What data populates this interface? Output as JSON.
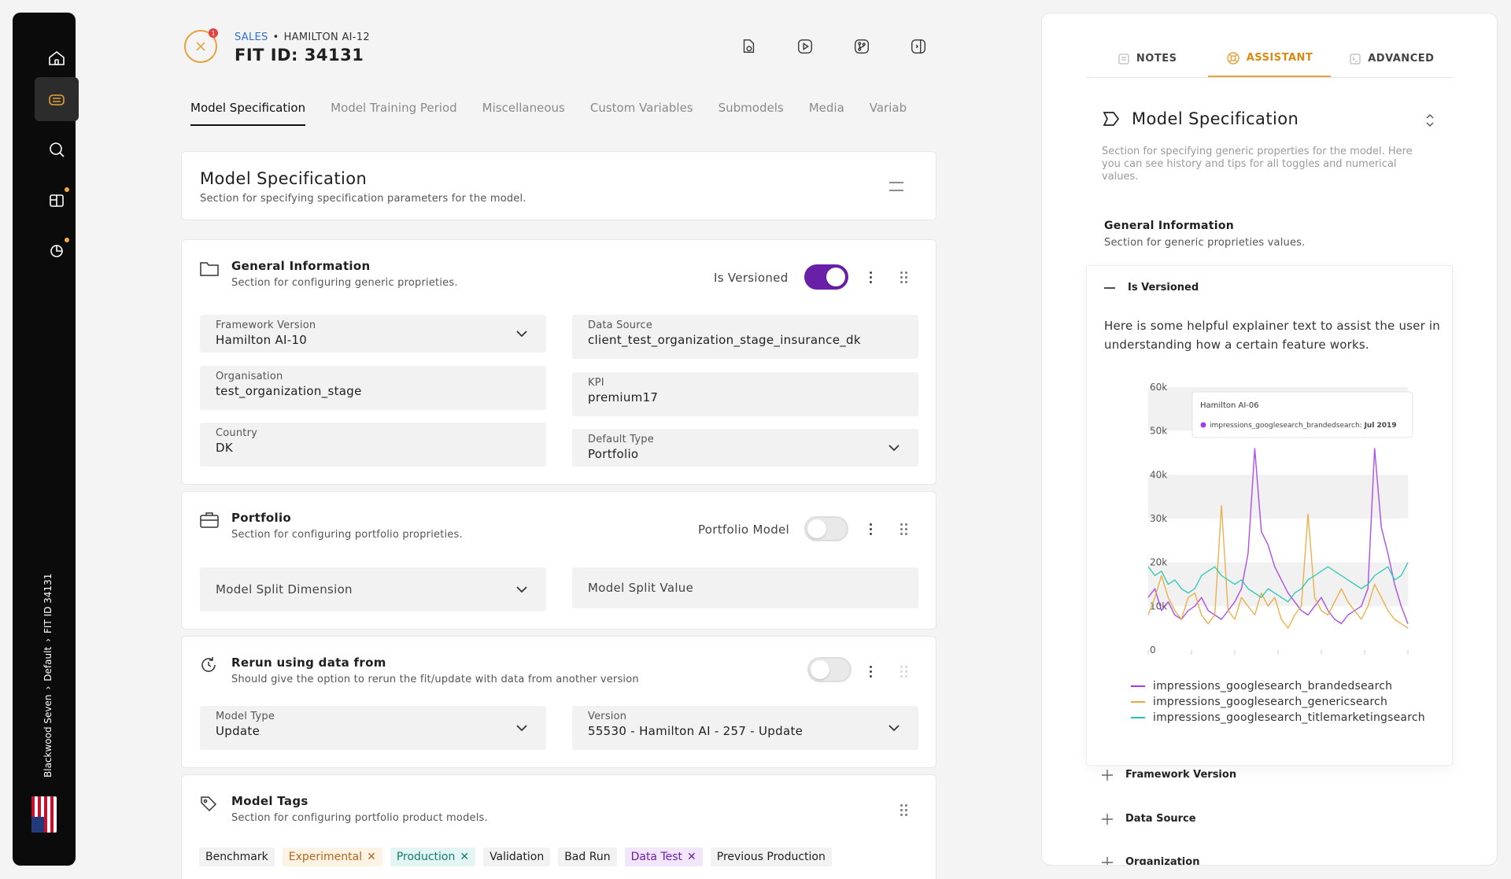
{
  "sidebar": {
    "breadcrumb": [
      "Blackwood Seven",
      "Default",
      "FIT ID 34131"
    ]
  },
  "header": {
    "breadcrumb_section": "SALES",
    "breadcrumb_separator": "•",
    "breadcrumb_model": "HAMILTON AI-12",
    "title": "FIT ID: 34131",
    "notification_count": "1"
  },
  "tabs": [
    {
      "label": "Model Specification",
      "active": true
    },
    {
      "label": "Model Training Period"
    },
    {
      "label": "Miscellaneous"
    },
    {
      "label": "Custom Variables"
    },
    {
      "label": "Submodels"
    },
    {
      "label": "Media"
    },
    {
      "label": "Variab"
    }
  ],
  "spec": {
    "title": "Model Specification",
    "subtitle": "Section for specifying specification parameters for the model."
  },
  "general": {
    "title": "General Information",
    "subtitle": "Section for configuring generic proprieties.",
    "toggle_label": "Is Versioned",
    "toggle_on": true,
    "fields": {
      "framework_version": {
        "label": "Framework Version",
        "value": "Hamilton AI-10"
      },
      "data_source": {
        "label": "Data Source",
        "value": "client_test_organization_stage_insurance_dk"
      },
      "organisation": {
        "label": "Organisation",
        "value": "test_organization_stage"
      },
      "kpi": {
        "label": "KPI",
        "value": "premium17"
      },
      "country": {
        "label": "Country",
        "value": "DK"
      },
      "default_type": {
        "label": "Default Type",
        "value": "Portfolio"
      }
    }
  },
  "portfolio": {
    "title": "Portfolio",
    "subtitle": "Section for configuring portfolio proprieties.",
    "toggle_label": "Portfolio Model",
    "toggle_on": false,
    "split_dimension_placeholder": "Model Split Dimension",
    "split_value_placeholder": "Model Split Value"
  },
  "rerun": {
    "title": "Rerun using data from",
    "subtitle": "Should give the option to rerun the fit/update with data from another version",
    "toggle_on": false,
    "model_type": {
      "label": "Model Type",
      "value": "Update"
    },
    "version": {
      "label": "Version",
      "value": "55530 - Hamilton AI - 257 - Update"
    }
  },
  "tags": {
    "title": "Model Tags",
    "subtitle": "Section for configuring portfolio product models.",
    "items": [
      {
        "label": "Benchmark"
      },
      {
        "label": "Experimental",
        "style": "exp"
      },
      {
        "label": "Production",
        "style": "prod"
      },
      {
        "label": "Validation"
      },
      {
        "label": "Bad Run"
      },
      {
        "label": "Data Test",
        "style": "dt"
      },
      {
        "label": "Previous Production"
      }
    ]
  },
  "panel": {
    "tabs": {
      "notes": "NOTES",
      "assistant": "ASSISTANT",
      "advanced": "ADVANCED"
    },
    "title": "Model Specification",
    "description": "Section for specifying generic properties for the model. Here you can see history and tips for all toggles and numerical values.",
    "general_title": "General Information",
    "general_subtitle": "Section for generic proprieties values.",
    "accordion": {
      "open_item": "Is Versioned",
      "text": "Here is some helpful explainer text to assist the user in understanding how a certain feature works.",
      "tooltip_title": "Hamilton AI-06",
      "tooltip_series": "impressions_googlesearch_brandedsearch:",
      "tooltip_value": "Jul 2019"
    },
    "collapsed_items": [
      "Framework Version",
      "Data Source",
      "Organization"
    ]
  },
  "colors": {
    "accent": "#e6a23c",
    "toggle_on": "#6a1fa8",
    "series_branded": "#a43ce6",
    "series_generic": "#e9a93a",
    "series_title": "#25c6b0"
  },
  "chart_data": {
    "type": "line",
    "y_ticks": [
      "60k",
      "50k",
      "40k",
      "30k",
      "20k",
      "10k",
      "0"
    ],
    "ylim": [
      0,
      60000
    ],
    "series": [
      {
        "name": "impressions_googlesearch_brandedsearch",
        "color": "#a43ce6",
        "values": [
          12000,
          14000,
          9000,
          11000,
          8000,
          7000,
          9000,
          10000,
          12000,
          9000,
          8000,
          7000,
          9000,
          11000,
          14000,
          22000,
          46000,
          27000,
          24000,
          19000,
          16000,
          13000,
          11000,
          9000,
          8000,
          10000,
          12000,
          9000,
          7000,
          6000,
          8000,
          9000,
          10000,
          14000,
          46000,
          28000,
          22000,
          15000,
          10000,
          6000
        ]
      },
      {
        "name": "impressions_googlesearch_genericsearch",
        "color": "#e9a93a",
        "values": [
          8000,
          12000,
          17000,
          12000,
          9000,
          7000,
          12000,
          13000,
          8000,
          6000,
          8000,
          33000,
          9000,
          7000,
          12000,
          10000,
          8000,
          13000,
          10000,
          12000,
          7000,
          5000,
          8000,
          10000,
          31000,
          12000,
          9000,
          8000,
          11000,
          14000,
          11000,
          9000,
          7000,
          10000,
          15000,
          12000,
          9000,
          7000,
          6000,
          5000
        ]
      },
      {
        "name": "impressions_googlesearch_titlemarketingsearch",
        "color": "#25c6b0",
        "values": [
          19000,
          17000,
          18000,
          15000,
          16000,
          14000,
          13000,
          14000,
          17000,
          18000,
          19000,
          17000,
          16000,
          15000,
          16000,
          14000,
          13000,
          12000,
          14000,
          13000,
          12000,
          11000,
          13000,
          14000,
          16000,
          17000,
          18000,
          19000,
          18000,
          17000,
          16000,
          15000,
          14000,
          15000,
          17000,
          18000,
          19000,
          16000,
          17000,
          20000
        ]
      }
    ]
  }
}
